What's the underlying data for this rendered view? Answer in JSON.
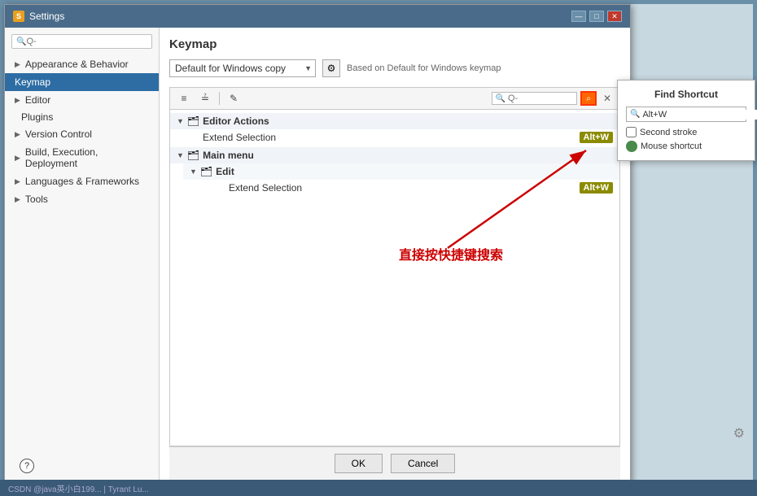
{
  "window": {
    "title": "Settings",
    "icon": "S"
  },
  "title_bar_controls": {
    "minimize": "—",
    "maximize": "□",
    "close": "✕"
  },
  "sidebar": {
    "search_placeholder": "Q-",
    "items": [
      {
        "id": "appearance",
        "label": "Appearance & Behavior",
        "arrow": "▶",
        "active": false
      },
      {
        "id": "keymap",
        "label": "Keymap",
        "active": true
      },
      {
        "id": "editor",
        "label": "Editor",
        "arrow": "▶",
        "active": false
      },
      {
        "id": "plugins",
        "label": "Plugins",
        "active": false
      },
      {
        "id": "version-control",
        "label": "Version Control",
        "arrow": "▶",
        "active": false
      },
      {
        "id": "build",
        "label": "Build, Execution, Deployment",
        "arrow": "▶",
        "active": false
      },
      {
        "id": "languages",
        "label": "Languages & Frameworks",
        "arrow": "▶",
        "active": false
      },
      {
        "id": "tools",
        "label": "Tools",
        "arrow": "▶",
        "active": false
      }
    ]
  },
  "keymap": {
    "title": "Keymap",
    "dropdown_value": "Default for Windows copy",
    "dropdown_arrow": "▼",
    "based_on_text": "Based on Default for Windows keymap",
    "toolbar": {
      "expand_icon": "≡",
      "collapse_icon": "≟",
      "edit_icon": "✎",
      "search_placeholder": "Q-",
      "search_shortcut_icon": "⌕",
      "close_icon": "✕"
    },
    "tree": {
      "sections": [
        {
          "id": "editor-actions",
          "label": "Editor Actions",
          "expanded": true,
          "folder_icon": "🗂",
          "items": [
            {
              "label": "Extend Selection",
              "shortcut": "Alt+W"
            }
          ]
        },
        {
          "id": "main-menu",
          "label": "Main menu",
          "expanded": true,
          "folder_icon": "🗂",
          "subsections": [
            {
              "id": "edit",
              "label": "Edit",
              "folder_icon": "🗂",
              "items": [
                {
                  "label": "Extend Selection",
                  "shortcut": "Alt+W"
                }
              ]
            }
          ]
        }
      ]
    },
    "buttons": {
      "ok": "OK",
      "cancel": "Cancel"
    },
    "help": "?"
  },
  "find_shortcut": {
    "title": "Find Shortcut",
    "search_icon": "🔍",
    "input_value": "Alt+W",
    "clear_btn": "✕",
    "second_stroke_label": "Second stroke",
    "mouse_shortcut_label": "Mouse shortcut"
  },
  "annotation": {
    "text": "直接按快捷键搜索"
  },
  "right_panel": {
    "gear_icon": "⚙"
  }
}
